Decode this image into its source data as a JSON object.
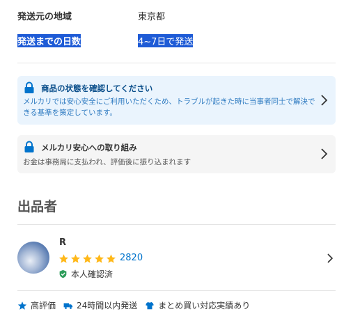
{
  "shipping": {
    "origin_label": "発送元の地域",
    "origin_value": "東京都",
    "days_label": "発送までの日数",
    "days_value": "4~7日で発送"
  },
  "notice_cards": [
    {
      "title": "商品の状態を確認してください",
      "description": "メルカリでは安心安全にご利用いただくため、トラブルが起きた時に当事者同士で解決できる基準を策定しています。",
      "icon": "lock-icon"
    },
    {
      "title": "メルカリ安心への取り組み",
      "description": "お金は事務局に支払われ、評価後に振り込まれます",
      "icon": "lock-icon"
    }
  ],
  "seller_section": {
    "title": "出品者",
    "name": "R",
    "rating_stars": 5,
    "rating_count": "2820",
    "verified_label": "本人確認済"
  },
  "badges": [
    {
      "label": "高評価",
      "icon": "star-icon"
    },
    {
      "label": "24時間以内発送",
      "icon": "truck-icon"
    },
    {
      "label": "まとめ買い対応実績あり",
      "icon": "shirt-icon"
    }
  ],
  "colors": {
    "accent_blue": "#0073cc",
    "star": "#ffb818",
    "verified_green": "#2e9d5b",
    "notice_bg": "#eaf4fd",
    "selection": "#1e5bd6"
  }
}
